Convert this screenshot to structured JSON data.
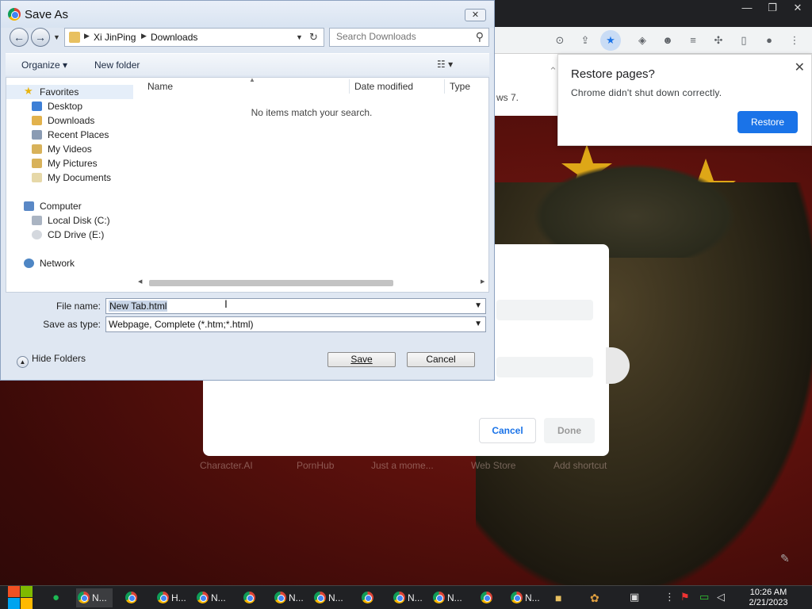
{
  "dialog": {
    "title": "Save As",
    "close_glyph": "✕",
    "nav": {
      "back_glyph": "←",
      "forward_glyph": "→",
      "breadcrumb": [
        "Xi JinPing",
        "Downloads"
      ],
      "refresh_glyph": "↻",
      "search_placeholder": "Search Downloads"
    },
    "toolbar": {
      "organize_label": "Organize ▾",
      "new_folder_label": "New folder",
      "view_label": "☷  ▾"
    },
    "sidebar": {
      "favorites_label": "Favorites",
      "favorites_items": [
        "Desktop",
        "Downloads",
        "Recent Places",
        "My Videos",
        "My Pictures",
        "My Documents"
      ],
      "computer_label": "Computer",
      "computer_items": [
        "Local Disk (C:)",
        "CD Drive (E:)"
      ],
      "network_label": "Network"
    },
    "columns": {
      "name": "Name",
      "date_modified": "Date modified",
      "type": "Type"
    },
    "empty_message": "No items match your search.",
    "file_name_label": "File name:",
    "file_name_value": "New Tab.html",
    "save_as_type_label": "Save as type:",
    "save_as_type_value": "Webpage, Complete (*.htm;*.html)",
    "hide_folders_label": "Hide Folders",
    "save_label": "Save",
    "cancel_label": "Cancel"
  },
  "browser": {
    "restore_popup": {
      "title": "Restore pages?",
      "message": "Chrome didn't shut down correctly.",
      "button": "Restore",
      "close_glyph": "✕"
    },
    "page_snippet": "ws 7.",
    "behind_dialog": {
      "cancel_label": "Cancel",
      "done_label": "Done"
    },
    "shortcuts": [
      "Character.AI",
      "PornHub",
      "Just a mome...",
      "Web Store",
      "Add shortcut"
    ]
  },
  "taskbar": {
    "apps": [
      {
        "label": "N..."
      },
      {
        "label": ""
      },
      {
        "label": "H..."
      },
      {
        "label": "N..."
      },
      {
        "label": ""
      },
      {
        "label": "N..."
      },
      {
        "label": "N..."
      },
      {
        "label": ""
      },
      {
        "label": "N..."
      },
      {
        "label": "N..."
      },
      {
        "label": ""
      },
      {
        "label": "N..."
      }
    ],
    "time": "10:26 AM",
    "date": "2/21/2023"
  },
  "colors": {
    "accent": "#1a73e8",
    "wallpaper_red": "#7a1a14",
    "flag_star": "#f4c21a",
    "chrome_alert": "#c8272c"
  }
}
